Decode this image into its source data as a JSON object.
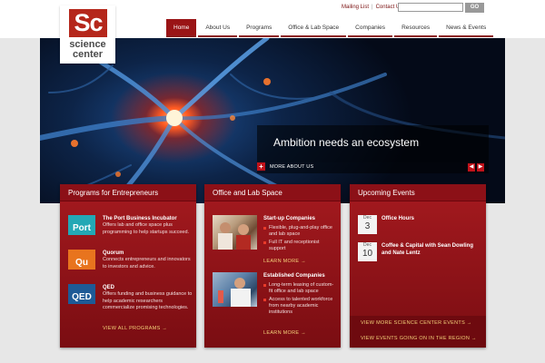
{
  "logo": {
    "mark": "Sc",
    "line1": "science",
    "line2": "center"
  },
  "utility": {
    "mailing_list": "Mailing List",
    "separator": "|",
    "contact_us": "Contact Us",
    "search_placeholder": "",
    "go_label": "GO"
  },
  "nav": {
    "items": [
      {
        "label": "Home",
        "active": true
      },
      {
        "label": "About Us"
      },
      {
        "label": "Programs"
      },
      {
        "label": "Office & Lab Space"
      },
      {
        "label": "Companies"
      },
      {
        "label": "Resources"
      },
      {
        "label": "News & Events"
      }
    ]
  },
  "hero": {
    "title": "Ambition needs an ecosystem",
    "more_label": "MORE ABOUT US",
    "plus": "+",
    "prev": "◀",
    "next": "▶"
  },
  "programs": {
    "heading": "Programs for Entrepreneurs",
    "items": [
      {
        "tile": "Port",
        "tile_color": "#23a8b5",
        "title": "The Port Business Incubator",
        "desc": "Offers lab and office space plus programming to help startups succeed."
      },
      {
        "tile": "Qu",
        "tile_color": "#e8741e",
        "title": "Quorum",
        "desc": "Connects entrepreneurs and innovators to investors and advice."
      },
      {
        "tile": "QED",
        "tile_color": "#1e5a96",
        "title": "QED",
        "desc": "Offers funding and business guidance to help academic researchers commercialize promising technologies."
      }
    ],
    "link": "VIEW ALL PROGRAMS →"
  },
  "office": {
    "heading": "Office and Lab Space",
    "sections": [
      {
        "title": "Start-up Companies",
        "bullets": [
          "Flexible, plug-and-play office and lab space",
          "Full IT and receptionist support"
        ],
        "link": "LEARN MORE →"
      },
      {
        "title": "Established Companies",
        "bullets": [
          "Long-term leasing of custom-fit office and lab space",
          "Access to talented workforce from nearby academic institutions"
        ],
        "link": "LEARN MORE →"
      }
    ]
  },
  "events": {
    "heading": "Upcoming Events",
    "items": [
      {
        "month": "Dec",
        "day": "3",
        "title": "Office Hours"
      },
      {
        "month": "Dec",
        "day": "10",
        "title": "Coffee & Capital with Sean Dowling and Nate Lentz"
      }
    ],
    "link1": "VIEW MORE SCIENCE CENTER EVENTS →",
    "link2": "VIEW EVENTS GOING ON IN THE REGION →"
  },
  "colors": {
    "brand_red": "#9a1416",
    "link_gold": "#f4d27a"
  }
}
